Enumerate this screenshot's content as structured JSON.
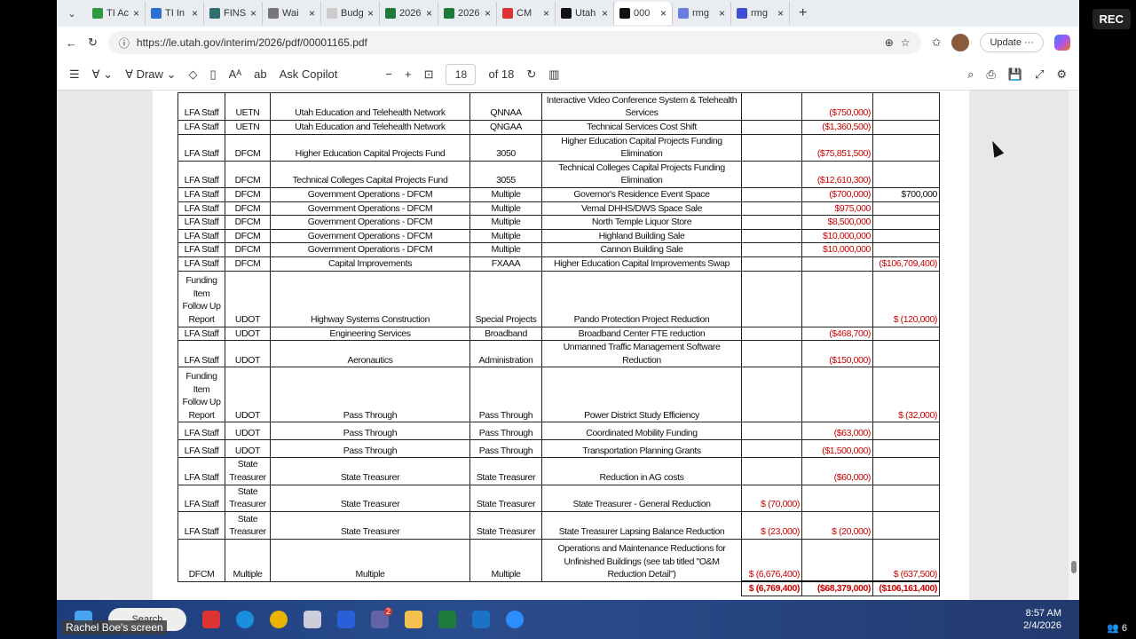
{
  "browser": {
    "tabs": [
      {
        "label": "TI Ac",
        "color": "#2e9b43"
      },
      {
        "label": "TI In",
        "color": "#2a6fd6"
      },
      {
        "label": "FINS",
        "color": "#2f6f6f"
      },
      {
        "label": "Wai",
        "color": "#777"
      },
      {
        "label": "Budg",
        "color": "#ccc"
      },
      {
        "label": "2026",
        "color": "#1d7a3a"
      },
      {
        "label": "2026",
        "color": "#1d7a3a"
      },
      {
        "label": "CM",
        "color": "#d33"
      },
      {
        "label": "Utah",
        "color": "#111"
      },
      {
        "label": "000",
        "color": "#111",
        "active": true
      },
      {
        "label": "rmg",
        "color": "#6a7ee0"
      },
      {
        "label": "rmg",
        "color": "#3b4fd0"
      }
    ],
    "url": "https://le.utah.gov/interim/2026/pdf/00001165.pdf",
    "update_label": "Update"
  },
  "pdf_toolbar": {
    "draw_label": "Draw",
    "copilot_label": "Ask Copilot",
    "page": "18",
    "page_total": "of 18"
  },
  "table": {
    "rows": [
      [
        "LFA Staff",
        "UETN",
        "Utah Education and Telehealth Network",
        "QNNAA",
        "Interactive Video Conference System & Telehealth Services",
        "",
        "($750,000)",
        ""
      ],
      [
        "LFA Staff",
        "UETN",
        "Utah Education and Telehealth Network",
        "QNGAA",
        "Technical Services Cost Shift",
        "",
        "($1,360,500)",
        ""
      ],
      [
        "LFA Staff",
        "DFCM",
        "Higher Education Capital Projects Fund",
        "3050",
        "Higher Education Capital Projects Funding Elimination",
        "",
        "($75,851,500)",
        ""
      ],
      [
        "LFA Staff",
        "DFCM",
        "Technical Colleges Capital Projects Fund",
        "3055",
        "Technical Colleges Capital Projects Funding Elimination",
        "",
        "($12,610,300)",
        ""
      ],
      [
        "LFA Staff",
        "DFCM",
        "Government Operations - DFCM",
        "Multiple",
        "Governor's Residence Event Space",
        "",
        "($700,000)",
        "$700,000"
      ],
      [
        "LFA Staff",
        "DFCM",
        "Government Operations - DFCM",
        "Multiple",
        "Vernal DHHS/DWS Space Sale",
        "",
        "$975,000",
        ""
      ],
      [
        "LFA Staff",
        "DFCM",
        "Government Operations - DFCM",
        "Multiple",
        "North Temple Liquor Store",
        "",
        "$8,500,000",
        ""
      ],
      [
        "LFA Staff",
        "DFCM",
        "Government Operations - DFCM",
        "Multiple",
        "Highland Building Sale",
        "",
        "$10,000,000",
        ""
      ],
      [
        "LFA Staff",
        "DFCM",
        "Government Operations - DFCM",
        "Multiple",
        "Cannon Building Sale",
        "",
        "$10,000,000",
        ""
      ],
      [
        "LFA Staff",
        "DFCM",
        "Capital Improvements",
        "FXAAA",
        "Higher Education Capital Improvements Swap",
        "",
        "",
        "($106,709,400)"
      ],
      [
        "Funding Item Follow Up Report",
        "UDOT",
        "Highway Systems Construction",
        "Special Projects",
        "Pando Protection Project Reduction",
        "",
        "",
        "$ (120,000)"
      ],
      [
        "LFA Staff",
        "UDOT",
        "Engineering Services",
        "Broadband",
        "Broadband Center FTE reduction",
        "",
        "($468,700)",
        ""
      ],
      [
        "LFA Staff",
        "UDOT",
        "Aeronautics",
        "Administration",
        "Unmanned Traffic Management Software Reduction",
        "",
        "($150,000)",
        ""
      ],
      [
        "Funding Item Follow Up Report",
        "UDOT",
        "Pass Through",
        "Pass Through",
        "Power District Study Efficiency",
        "",
        "",
        "$ (32,000)"
      ],
      [
        "LFA Staff",
        "UDOT",
        "Pass Through",
        "Pass Through",
        "Coordinated Mobility Funding",
        "",
        "($63,000)",
        ""
      ],
      [
        "LFA Staff",
        "UDOT",
        "Pass Through",
        "Pass Through",
        "Transportation Planning Grants",
        "",
        "($1,500,000)",
        ""
      ],
      [
        "LFA Staff",
        "State Treasurer",
        "State Treasurer",
        "State Treasurer",
        "Reduction in AG costs",
        "",
        "($60,000)",
        ""
      ],
      [
        "LFA Staff",
        "State Treasurer",
        "State Treasurer",
        "State Treasurer",
        "State Treasurer - General Reduction",
        "$ (70,000)",
        "",
        ""
      ],
      [
        "LFA Staff",
        "State Treasurer",
        "State Treasurer",
        "State Treasurer",
        "State Treasurer Lapsing Balance Reduction",
        "$ (23,000)",
        "$ (20,000)",
        ""
      ],
      [
        "DFCM",
        "Multiple",
        "Multiple",
        "Multiple",
        "Operations and Maintenance Reductions for Unfinished Buildings (see tab titled \"O&M Reduction Detail\")",
        "$ (6,676,400)",
        "",
        "$ (637,500)"
      ]
    ],
    "totals": [
      "$ (6,769,400)",
      "($68,379,000)",
      "($106,161,400)"
    ]
  },
  "taskbar": {
    "search": "Search",
    "time": "8:57 AM",
    "date": "2/4/2026",
    "badge": "2"
  },
  "overlay": {
    "screen_label": "Rachel Boe's screen",
    "rec": "REC",
    "participants": "6"
  }
}
